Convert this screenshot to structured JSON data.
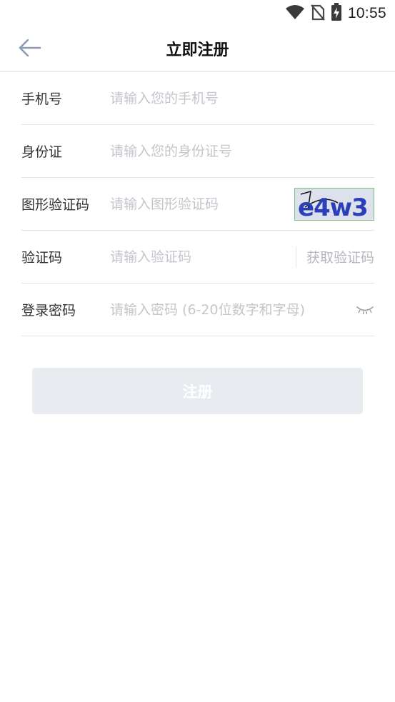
{
  "status_bar": {
    "time": "10:55",
    "icons": [
      "wifi-icon",
      "no-sim-icon",
      "battery-charging-icon"
    ]
  },
  "header": {
    "back_icon": "arrow-left-icon",
    "title": "立即注册"
  },
  "form": {
    "phone": {
      "label": "手机号",
      "placeholder": "请输入您的手机号"
    },
    "id_card": {
      "label": "身份证",
      "placeholder": "请输入您的身份证号"
    },
    "image_captcha": {
      "label": "图形验证码",
      "placeholder": "请输入图形验证码",
      "captcha_text": "e4w3"
    },
    "sms_code": {
      "label": "验证码",
      "placeholder": "请输入验证码",
      "get_code_label": "获取验证码"
    },
    "password": {
      "label": "登录密码",
      "placeholder": "请输入密码 (6-20位数字和字母)",
      "toggle_icon": "eye-closed-icon"
    }
  },
  "register_button": {
    "label": "注册"
  },
  "colors": {
    "accent_back_arrow": "#8f9bb3",
    "placeholder": "#c4c6cc",
    "button_disabled_bg": "#e8ebf0",
    "divider": "#e3e3e3"
  }
}
